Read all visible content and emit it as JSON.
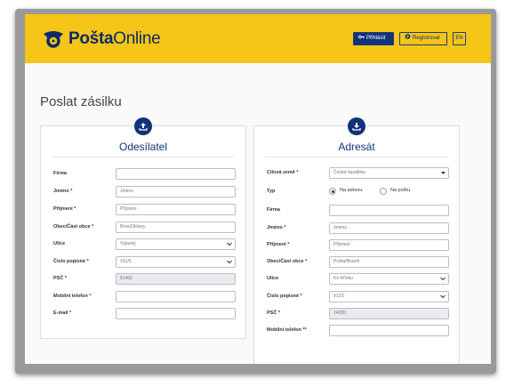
{
  "header": {
    "logo_bold": "Pošta",
    "logo_light": "Online",
    "login_label": "Přihlásit",
    "register_label": "Registrovat",
    "lang_label": "EN"
  },
  "page": {
    "title": "Poslat zásilku"
  },
  "sender": {
    "title": "Odesílatel",
    "fields": [
      {
        "label": "Firma",
        "value": ""
      },
      {
        "label": "Jméno *",
        "value": "Jméno"
      },
      {
        "label": "Příjmení *",
        "value": "Příjmení"
      },
      {
        "label": "Obec/Část obce *",
        "value": "Brno/Obřany"
      },
      {
        "label": "Ulice",
        "value": "Výpusty"
      },
      {
        "label": "Číslo popisné *",
        "value": "161/5"
      },
      {
        "label": "PSČ *",
        "value": "61400"
      },
      {
        "label": "Mobilní telefon *",
        "value": ""
      },
      {
        "label": "E-mail *",
        "value": ""
      }
    ]
  },
  "recipient": {
    "title": "Adresát",
    "fields": [
      {
        "label": "Cílová země *",
        "value": "Česká republika"
      },
      {
        "label": "Typ",
        "value": ""
      },
      {
        "label": "Firma",
        "value": ""
      },
      {
        "label": "Jméno *",
        "value": "Jméno"
      },
      {
        "label": "Příjmení *",
        "value": "Příjmení"
      },
      {
        "label": "Obec/Část obce *",
        "value": "Praha/Braník"
      },
      {
        "label": "Ulice",
        "value": "Ke Křínku"
      },
      {
        "label": "Číslo popisné *",
        "value": "912/2"
      },
      {
        "label": "PSČ *",
        "value": "14000"
      },
      {
        "label": "Mobilní telefon **",
        "value": ""
      }
    ],
    "type_options": [
      "Na adresu",
      "Na poštu"
    ],
    "type_selected": "Na adresu"
  },
  "colors": {
    "brand_yellow": "#f5c518",
    "brand_navy": "#12327a"
  },
  "icons": {
    "sender": "upload-icon",
    "recipient": "download-icon",
    "login": "key-icon",
    "register": "plus-circle-icon"
  }
}
